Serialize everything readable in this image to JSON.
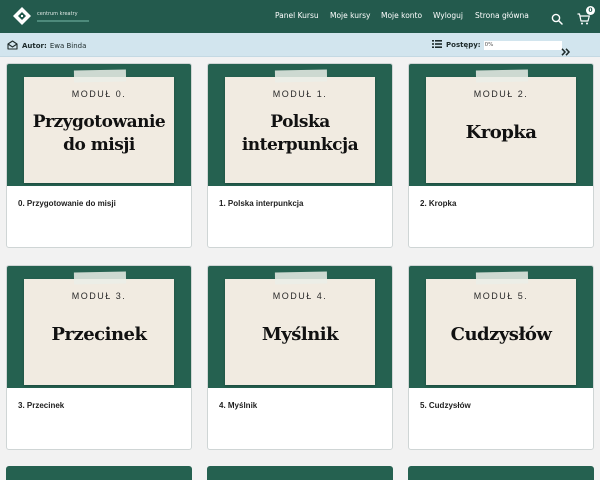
{
  "header": {
    "logo_text": "centrum kreatry",
    "nav": [
      {
        "label": "Panel Kursu"
      },
      {
        "label": "Moje kursy"
      },
      {
        "label": "Moje konto"
      },
      {
        "label": "Wyloguj"
      },
      {
        "label": "Strona główna"
      }
    ],
    "cart_count": "0",
    "icons": [
      "logo-icon",
      "search-icon",
      "cart-icon"
    ]
  },
  "subbar": {
    "author_label": "Autor:",
    "author_name": "Ewa Binda",
    "progress_label": "Postępy:",
    "progress_text": "0%",
    "progress_value": 0,
    "icons": [
      "open-envelope-icon",
      "list-icon",
      "double-chevron-right-icon"
    ]
  },
  "modules": [
    {
      "label": "MODUŁ 0.",
      "title_lines": [
        "Przygotowanie",
        "do misji"
      ],
      "caption": "0. Przygotowanie do misji"
    },
    {
      "label": "MODUŁ 1.",
      "title_lines": [
        "Polska",
        "interpunkcja"
      ],
      "caption": "1. Polska interpunkcja"
    },
    {
      "label": "MODUŁ 2.",
      "title_lines": [
        "Kropka"
      ],
      "caption": "2. Kropka"
    },
    {
      "label": "MODUŁ 3.",
      "title_lines": [
        "Przecinek"
      ],
      "caption": "3. Przecinek"
    },
    {
      "label": "MODUŁ 4.",
      "title_lines": [
        "Myślnik"
      ],
      "caption": "4. Myślnik"
    },
    {
      "label": "MODUŁ 5.",
      "title_lines": [
        "Cudzysłów"
      ],
      "caption": "5. Cudzysłów"
    }
  ],
  "colors": {
    "header_bg": "#235a4d",
    "subbar_bg": "#d2e5ee",
    "card_green": "#256150",
    "paper": "#f1ebe1"
  }
}
